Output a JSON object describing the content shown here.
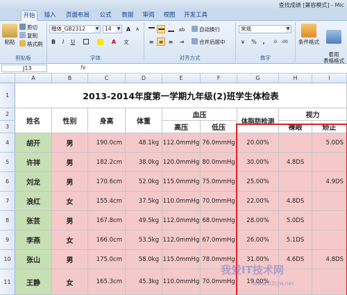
{
  "window": {
    "title": "查找成绩 [兼容模式] - Mic"
  },
  "tabs": [
    "开始",
    "插入",
    "页面布局",
    "公式",
    "数据",
    "审阅",
    "视图",
    "开发工具"
  ],
  "ribbon": {
    "clipboard": {
      "paste": "粘贴",
      "cut": "剪切",
      "copy": "复制",
      "format_painter": "格式刷",
      "label": "剪贴板"
    },
    "font": {
      "name": "楷体_GB2312",
      "size": "14",
      "bold": "B",
      "italic": "I",
      "underline": "U",
      "grow": "A",
      "shrink": "A",
      "label": "字体"
    },
    "alignment": {
      "wrap": "自动换行",
      "merge": "合并后居中",
      "label": "对齐方式"
    },
    "number": {
      "format": "常规",
      "percent": "%",
      "comma": ",",
      "label": "数字"
    },
    "styles": {
      "conditional": "条件格式",
      "table": "套用\n表格格式"
    }
  },
  "formula_bar": {
    "cell_ref": "J13",
    "fx": "fx"
  },
  "columns": [
    "A",
    "B",
    "C",
    "D",
    "E",
    "F",
    "G",
    "H",
    "I"
  ],
  "rows": [
    "1",
    "2",
    "3",
    "4",
    "5",
    "6",
    "7",
    "8",
    "9",
    "10",
    "11"
  ],
  "sheet": {
    "title": "2013-2014年度第一学期九年级(2)班学生体检表",
    "headers": {
      "name": "姓名",
      "gender": "性别",
      "height": "身高",
      "weight": "体重",
      "bp": "血压",
      "bp_high": "高压",
      "bp_low": "低压",
      "fat": "体脂肪检测",
      "vision": "视力",
      "naked": "裸眼",
      "corrected": "矫正"
    },
    "records": [
      {
        "name": "胡开",
        "gender": "男",
        "height": "190.0cm",
        "weight": "48.1kg",
        "high": "112.0mmHg",
        "low": "76.0mmHg",
        "fat": "20.00%",
        "naked": "",
        "corrected": "5.0DS"
      },
      {
        "name": "许祥",
        "gender": "男",
        "height": "182.2cm",
        "weight": "38.0kg",
        "high": "120.0mmHg",
        "low": "80.0mmHg",
        "fat": "30.00%",
        "naked": "4.8DS",
        "corrected": ""
      },
      {
        "name": "刘龙",
        "gender": "男",
        "height": "170.6cm",
        "weight": "52.0kg",
        "high": "115.0mmHg",
        "low": "75.0mmHg",
        "fat": "25.00%",
        "naked": "",
        "corrected": "4.9DS"
      },
      {
        "name": "浪红",
        "gender": "女",
        "height": "155.4cm",
        "weight": "37.5kg",
        "high": "110.0mmHg",
        "low": "70.0mmHg",
        "fat": "22.00%",
        "naked": "4.8DS",
        "corrected": ""
      },
      {
        "name": "张芸",
        "gender": "男",
        "height": "167.8cm",
        "weight": "49.5kg",
        "high": "112.0mmHg",
        "low": "68.0mmHg",
        "fat": "28.00%",
        "naked": "5.0DS",
        "corrected": ""
      },
      {
        "name": "李燕",
        "gender": "女",
        "height": "166.0cm",
        "weight": "53.5kg",
        "high": "112.0mmHg",
        "low": "67.0mmHg",
        "fat": "26.00%",
        "naked": "5.1DS",
        "corrected": ""
      },
      {
        "name": "张山",
        "gender": "男",
        "height": "175.0cm",
        "weight": "58.0kg",
        "high": "115.0mmHg",
        "low": "78.0mmHg",
        "fat": "31.00%",
        "naked": "4.6DS",
        "corrected": "4.8DS"
      },
      {
        "name": "王静",
        "gender": "女",
        "height": "165.3cm",
        "weight": "45.3kg",
        "high": "110.0mmHg",
        "low": "70.0mmHg",
        "fat": "19.00%",
        "naked": "",
        "corrected": ""
      }
    ]
  },
  "watermark": {
    "main": "我爱IT技术网",
    "sub": "www.52cjw.net"
  },
  "colors": {
    "name_fill": "#c6dfb4",
    "body_fill": "#f5c9c9",
    "header_fill": "#ffffff",
    "highlight_border": "#d9202b",
    "ribbon": "#dbe6f5"
  }
}
